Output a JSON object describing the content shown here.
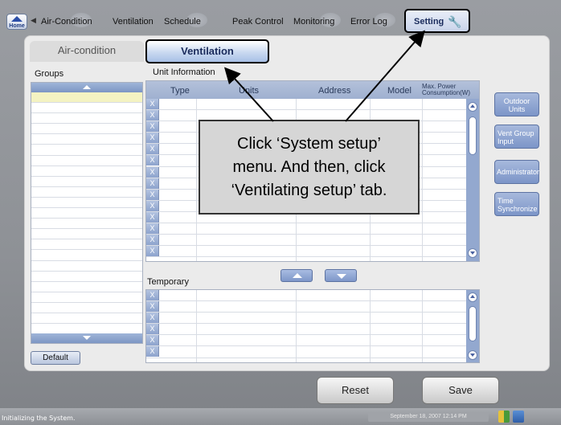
{
  "nav": {
    "home_label": "Home",
    "tabs": [
      "Air-Condition",
      "Ventilation",
      "Schedule",
      "Peak Control",
      "Monitoring",
      "Error Log",
      "Setting"
    ]
  },
  "subtabs": {
    "air": "Air-condition",
    "vent": "Ventilation"
  },
  "groups": {
    "title": "Groups",
    "default_label": "Default"
  },
  "unit_info": {
    "title": "Unit Information",
    "columns": [
      "Type",
      "Units",
      "Address",
      "Model",
      "Max. Power Consumption(W)"
    ],
    "row_button": "X"
  },
  "temporary": {
    "title": "Temporary",
    "row_button": "X"
  },
  "side_buttons": [
    "Outdoor Units",
    "Vent Group Input",
    "Administrator",
    "Time Synchronize"
  ],
  "callout": {
    "line1": "Click ‘System setup’",
    "line2": "menu. And then, click",
    "line3": "‘Ventilating setup’ tab."
  },
  "actions": {
    "reset": "Reset",
    "save": "Save"
  },
  "status": {
    "text": "Initializing the System.",
    "datetime": "September 18, 2007 12:14 PM"
  },
  "colors": {
    "accent": "#7c95c8",
    "highlight_row": "#f4f3c2"
  }
}
